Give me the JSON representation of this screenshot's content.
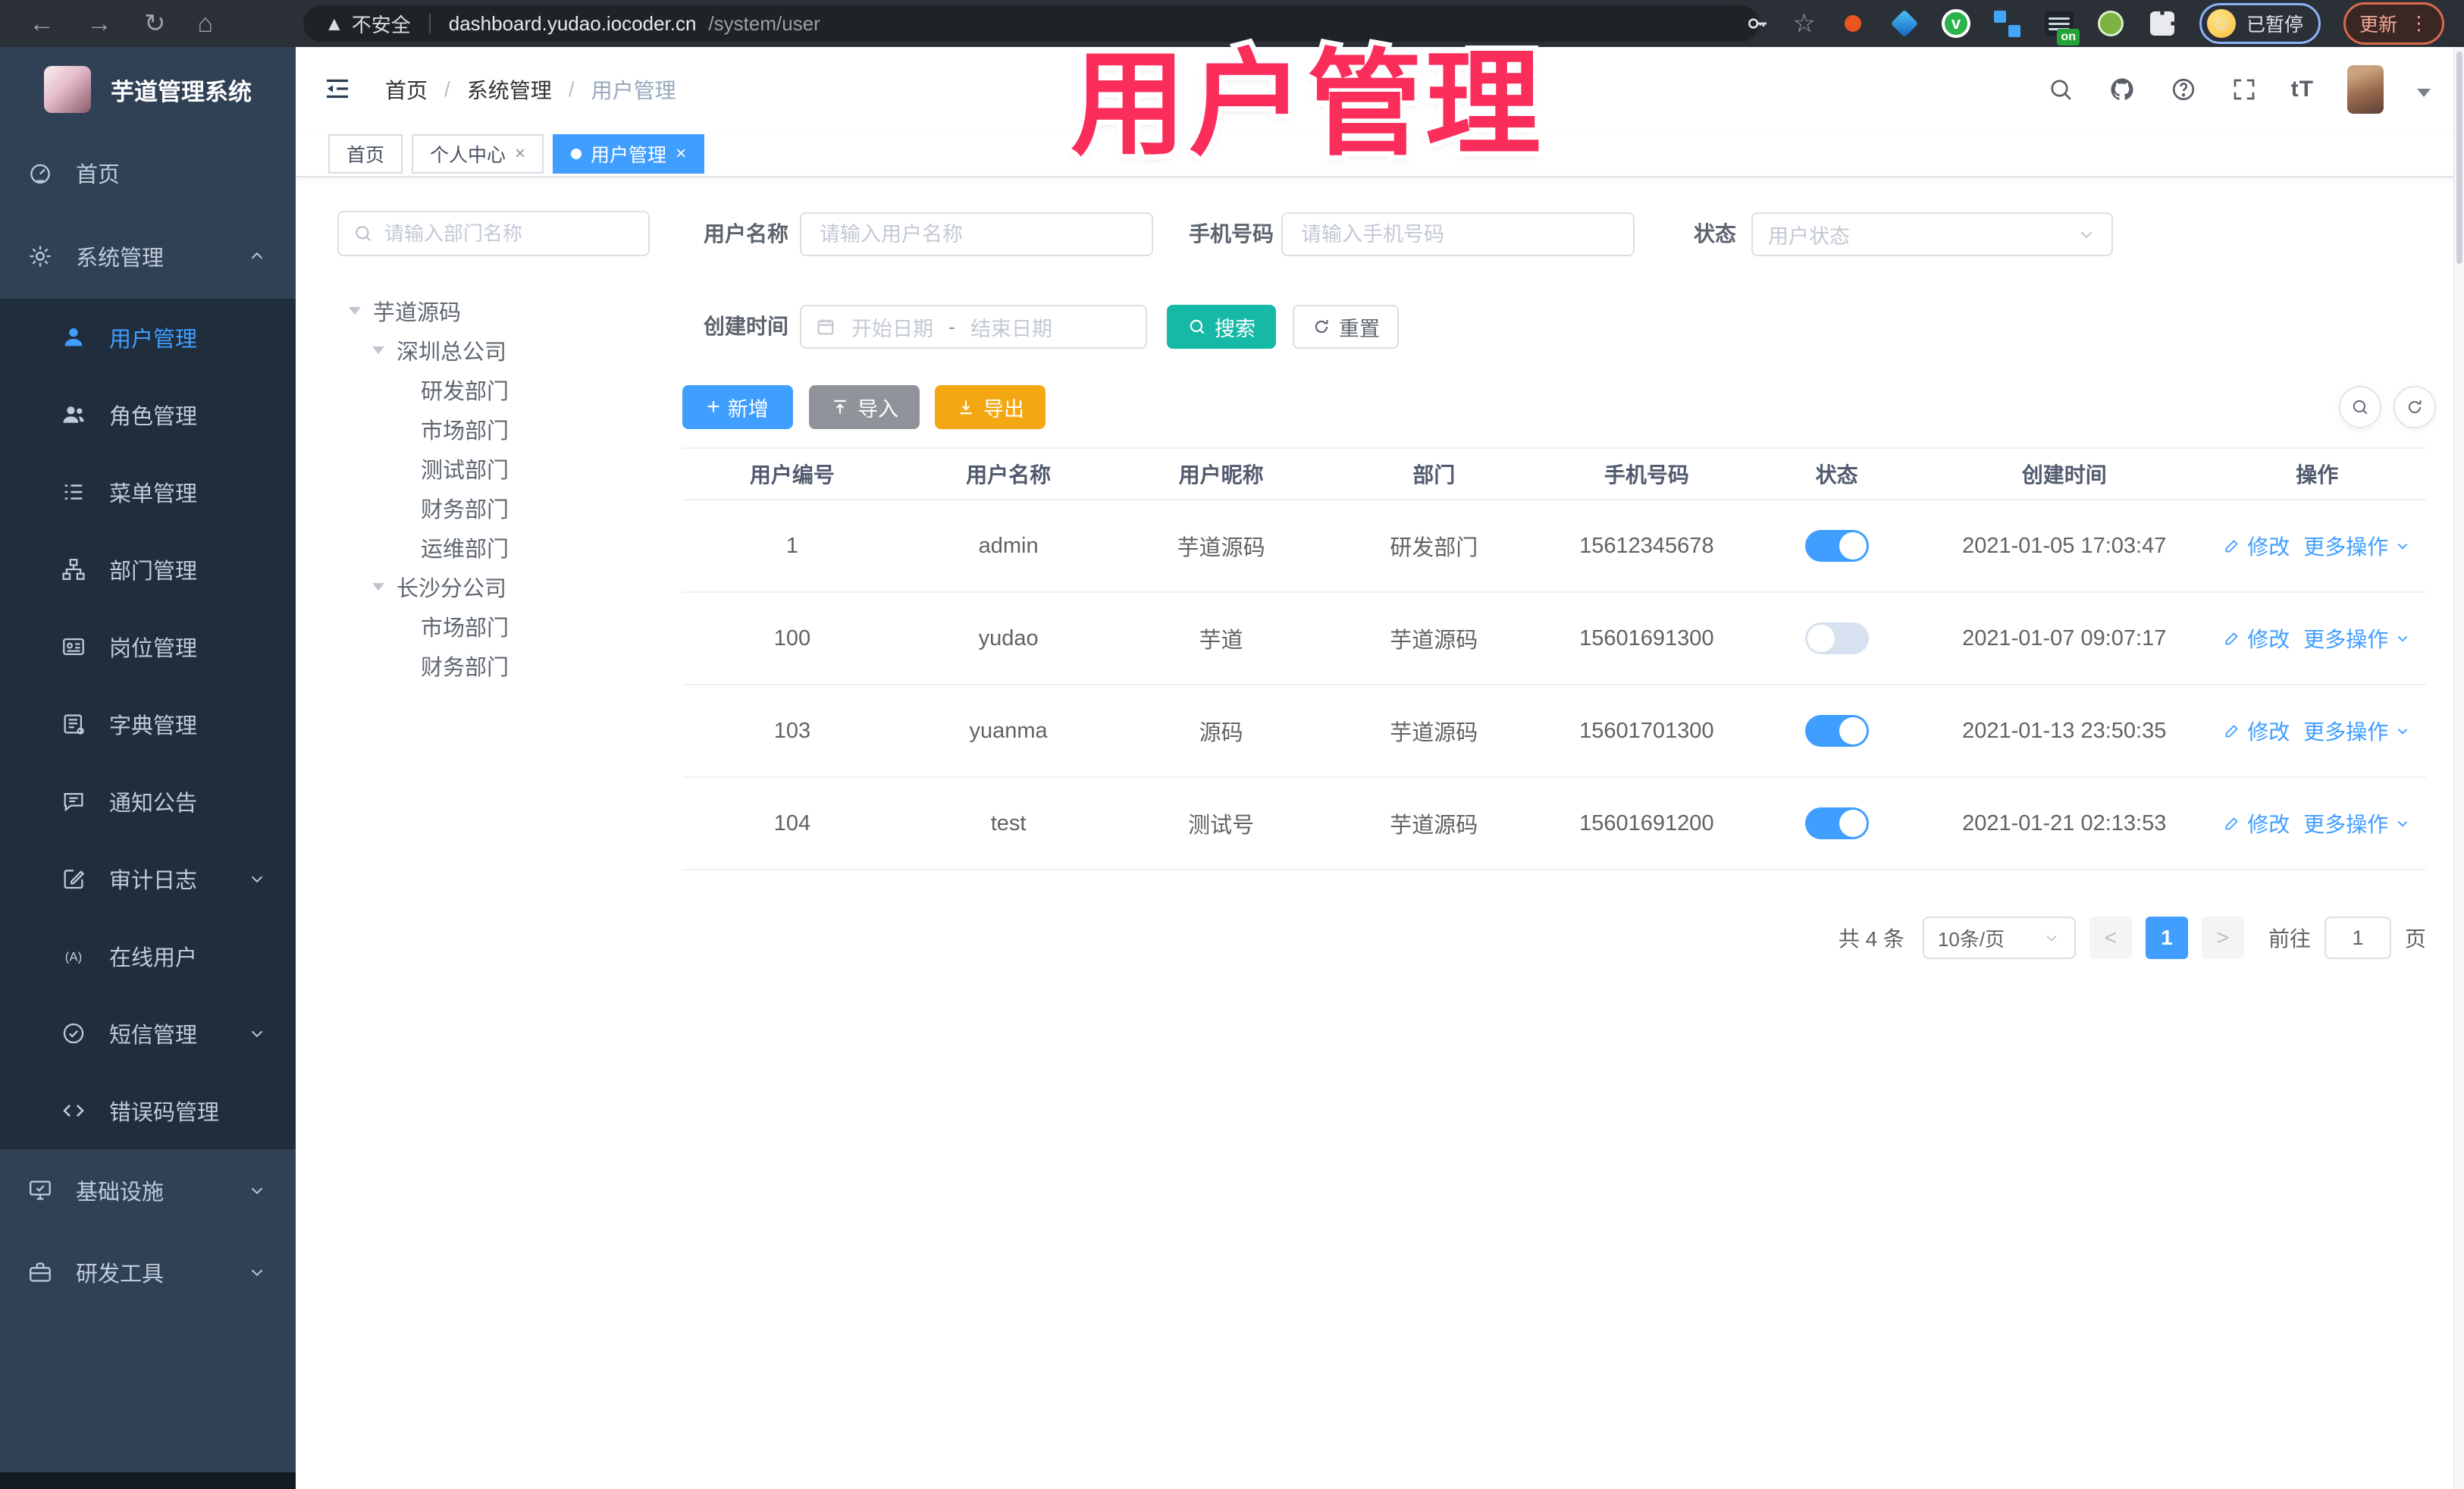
{
  "watermark": {
    "text": "用户管理"
  },
  "browser": {
    "security": "不安全",
    "url_host": "dashboard.yudao.iocoder.cn",
    "url_path": "/system/user",
    "extension_on_badge": "on",
    "green_ext_letter": "v",
    "profile_status": "已暂停",
    "update_label": "更新"
  },
  "sidebar": {
    "app_title": "芋道管理系统",
    "items": [
      {
        "label": "首页"
      },
      {
        "label": "系统管理"
      },
      {
        "label": "用户管理"
      },
      {
        "label": "角色管理"
      },
      {
        "label": "菜单管理"
      },
      {
        "label": "部门管理"
      },
      {
        "label": "岗位管理"
      },
      {
        "label": "字典管理"
      },
      {
        "label": "通知公告"
      },
      {
        "label": "审计日志"
      },
      {
        "label": "在线用户"
      },
      {
        "label": "短信管理"
      },
      {
        "label": "错误码管理"
      },
      {
        "label": "基础设施"
      },
      {
        "label": "研发工具"
      }
    ]
  },
  "header": {
    "breadcrumb": [
      {
        "label": "首页"
      },
      {
        "label": "系统管理"
      },
      {
        "label": "用户管理"
      }
    ],
    "separator": "/"
  },
  "tabs": [
    {
      "label": "首页"
    },
    {
      "label": "个人中心"
    },
    {
      "label": "用户管理"
    }
  ],
  "dept_panel": {
    "search_placeholder": "请输入部门名称",
    "tree": [
      {
        "label": "芋道源码"
      },
      {
        "label": "深圳总公司"
      },
      {
        "label": "研发部门"
      },
      {
        "label": "市场部门"
      },
      {
        "label": "测试部门"
      },
      {
        "label": "财务部门"
      },
      {
        "label": "运维部门"
      },
      {
        "label": "长沙分公司"
      },
      {
        "label": "市场部门"
      },
      {
        "label": "财务部门"
      }
    ]
  },
  "filters": {
    "username_label": "用户名称",
    "username_placeholder": "请输入用户名称",
    "mobile_label": "手机号码",
    "mobile_placeholder": "请输入手机号码",
    "status_label": "状态",
    "status_placeholder": "用户状态",
    "create_time_label": "创建时间",
    "date_start_placeholder": "开始日期",
    "date_separator": "-",
    "date_end_placeholder": "结束日期",
    "search_label": "搜索",
    "reset_label": "重置"
  },
  "toolbar": {
    "add_label": "新增",
    "import_label": "导入",
    "export_label": "导出"
  },
  "table": {
    "columns": [
      "用户编号",
      "用户名称",
      "用户昵称",
      "部门",
      "手机号码",
      "状态",
      "创建时间",
      "操作"
    ],
    "edit_label": "修改",
    "more_label": "更多操作",
    "rows": [
      {
        "id": "1",
        "username": "admin",
        "nickname": "芋道源码",
        "dept": "研发部门",
        "mobile": "15612345678",
        "status_on": true,
        "created": "2021-01-05 17:03:47"
      },
      {
        "id": "100",
        "username": "yudao",
        "nickname": "芋道",
        "dept": "芋道源码",
        "mobile": "15601691300",
        "status_on": false,
        "created": "2021-01-07 09:07:17"
      },
      {
        "id": "103",
        "username": "yuanma",
        "nickname": "源码",
        "dept": "芋道源码",
        "mobile": "15601701300",
        "status_on": true,
        "created": "2021-01-13 23:50:35"
      },
      {
        "id": "104",
        "username": "test",
        "nickname": "测试号",
        "dept": "芋道源码",
        "mobile": "15601691200",
        "status_on": true,
        "created": "2021-01-21 02:13:53"
      }
    ]
  },
  "pagination": {
    "total_text": "共 4 条",
    "page_size": "10条/页",
    "prev": "<",
    "next": ">",
    "current_page": "1",
    "goto_label": "前往",
    "goto_value": "1",
    "page_unit": "页"
  },
  "colors": {
    "primary": "#409eff",
    "search_button": "#16b8a6",
    "export_button": "#f3a712",
    "import_button": "#909399",
    "watermark_pink": "#fb2d5b",
    "sidebar_bg": "#304156",
    "submenu_bg": "#1f2d3d"
  }
}
